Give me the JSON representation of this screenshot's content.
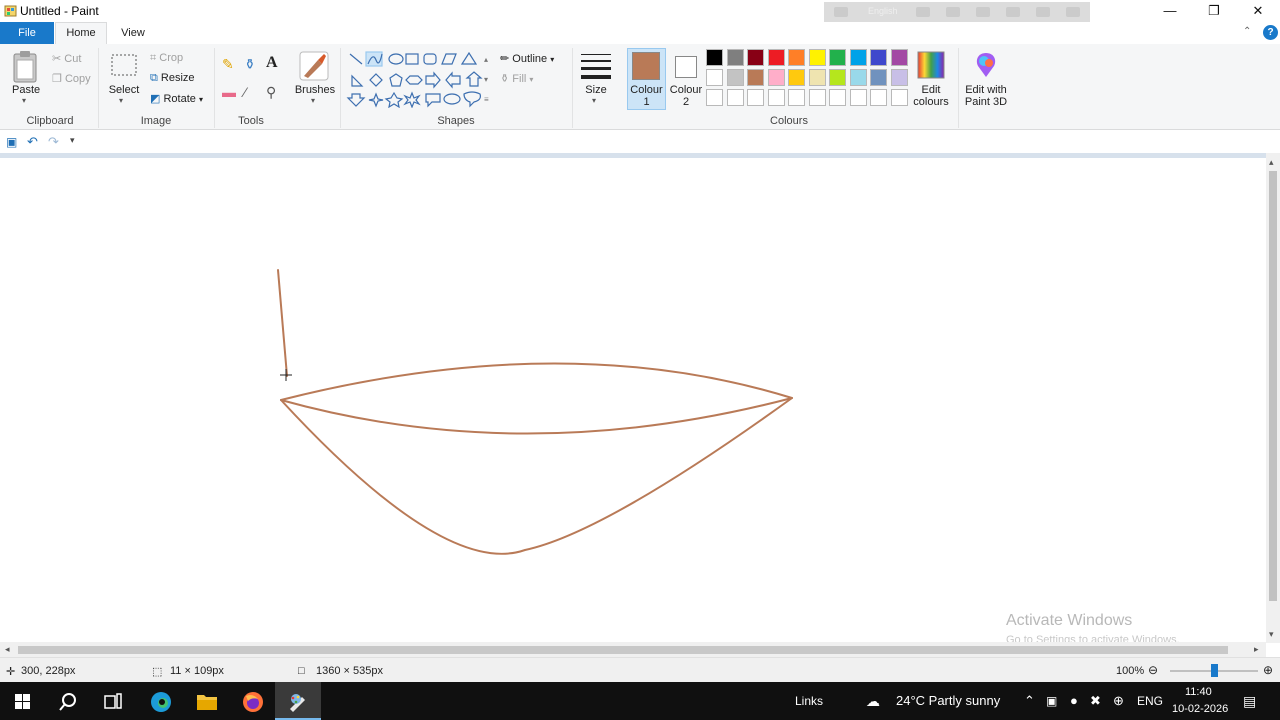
{
  "window": {
    "title": "Untitled - Paint",
    "remote_lang": "English"
  },
  "tabs": {
    "file": "File",
    "home": "Home",
    "view": "View"
  },
  "clipboard": {
    "paste": "Paste",
    "cut": "Cut",
    "copy": "Copy",
    "label": "Clipboard"
  },
  "image": {
    "select": "Select",
    "crop": "Crop",
    "resize": "Resize",
    "rotate": "Rotate",
    "label": "Image"
  },
  "tools": {
    "label": "Tools",
    "text_glyph": "A"
  },
  "brushes": {
    "label": "Brushes"
  },
  "shapes": {
    "outline": "Outline",
    "fill": "Fill",
    "label": "Shapes"
  },
  "size": {
    "label": "Size"
  },
  "colours": {
    "colour1": "Colour 1",
    "colour2": "Colour 2",
    "label": "Colours",
    "edit": "Edit colours",
    "paint3d": "Edit with Paint 3D",
    "selected1": "#b97a57",
    "selected2": "#ffffff",
    "row1": [
      "#000000",
      "#7f7f7f",
      "#880015",
      "#ed1c24",
      "#ff7f27",
      "#fff200",
      "#22b14c",
      "#00a2e8",
      "#3f48cc",
      "#a349a4"
    ],
    "row2": [
      "#ffffff",
      "#c3c3c3",
      "#b97a57",
      "#ffaec9",
      "#ffc90e",
      "#efe4b0",
      "#b5e61d",
      "#99d9ea",
      "#7092be",
      "#c8bfe7"
    ],
    "row3": [
      "#ffffff",
      "#ffffff",
      "#ffffff",
      "#ffffff",
      "#ffffff",
      "#ffffff",
      "#ffffff",
      "#ffffff",
      "#ffffff",
      "#ffffff"
    ]
  },
  "drawing": {
    "stroke_color": "#b97a57"
  },
  "watermark": {
    "line1": "Activate Windows",
    "line2": "Go to Settings to activate Windows."
  },
  "status": {
    "cursor": "300, 228px",
    "selection": "11 × 109px",
    "canvas_size": "1360 × 535px",
    "zoom": "100%",
    "zoom_level_fraction": 0.5
  },
  "taskbar": {
    "links": "Links",
    "weather": "24°C  Partly sunny",
    "lang": "ENG",
    "time": "11:40",
    "date": "10-02-2026"
  }
}
